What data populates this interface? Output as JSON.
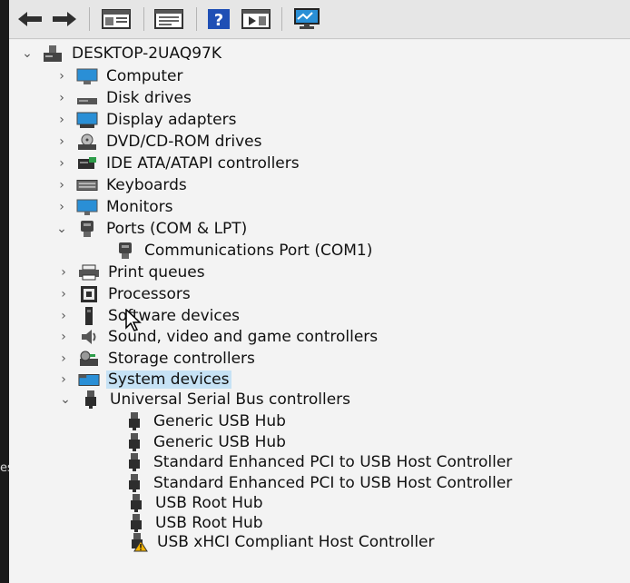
{
  "left_edge_text": "es",
  "toolbar": {
    "buttons": [
      {
        "icon": "back-arrow-icon"
      },
      {
        "icon": "forward-arrow-icon"
      },
      {
        "icon": "show-hide-console-tree-icon"
      },
      {
        "icon": "properties-icon"
      },
      {
        "icon": "help-icon"
      },
      {
        "icon": "action-pane-icon"
      },
      {
        "icon": "scan-hardware-icon"
      }
    ]
  },
  "tree": {
    "root": {
      "label": "DESKTOP-2UAQ97K",
      "icon": "computer-tower-icon",
      "expanded": true
    },
    "categories": [
      {
        "label": "Computer",
        "icon": "computer-icon",
        "expanded": false
      },
      {
        "label": "Disk drives",
        "icon": "disk-drive-icon",
        "expanded": false
      },
      {
        "label": "Display adapters",
        "icon": "display-adapter-icon",
        "expanded": false
      },
      {
        "label": "DVD/CD-ROM drives",
        "icon": "dvd-drive-icon",
        "expanded": false
      },
      {
        "label": "IDE ATA/ATAPI controllers",
        "icon": "ide-controller-icon",
        "expanded": false
      },
      {
        "label": "Keyboards",
        "icon": "keyboard-icon",
        "expanded": false
      },
      {
        "label": "Monitors",
        "icon": "monitor-icon",
        "expanded": false
      },
      {
        "label": "Ports (COM & LPT)",
        "icon": "port-icon",
        "expanded": true,
        "children": [
          {
            "label": "Communications Port (COM1)",
            "icon": "port-icon"
          }
        ]
      },
      {
        "label": "Print queues",
        "icon": "printer-icon",
        "expanded": false
      },
      {
        "label": "Processors",
        "icon": "processor-icon",
        "expanded": false
      },
      {
        "label": "Software devices",
        "icon": "software-device-icon",
        "expanded": false
      },
      {
        "label": "Sound, video and game controllers",
        "icon": "speaker-icon",
        "expanded": false
      },
      {
        "label": "Storage controllers",
        "icon": "storage-controller-icon",
        "expanded": false
      },
      {
        "label": "System devices",
        "icon": "system-devices-icon",
        "expanded": false,
        "selected": true
      },
      {
        "label": "Universal Serial Bus controllers",
        "icon": "usb-icon",
        "expanded": true,
        "children": [
          {
            "label": "Generic USB Hub",
            "icon": "usb-icon"
          },
          {
            "label": "Generic USB Hub",
            "icon": "usb-icon"
          },
          {
            "label": "Standard Enhanced PCI to USB Host Controller",
            "icon": "usb-icon"
          },
          {
            "label": "Standard Enhanced PCI to USB Host Controller",
            "icon": "usb-icon"
          },
          {
            "label": "USB Root Hub",
            "icon": "usb-icon"
          },
          {
            "label": "USB Root Hub",
            "icon": "usb-icon"
          },
          {
            "label": "USB xHCI Compliant Host Controller",
            "icon": "usb-warning-icon",
            "warning": true
          }
        ]
      }
    ]
  },
  "colors": {
    "selection": "#c6e2f5",
    "warning": "#f2b100",
    "icon_blue": "#2a8fd6"
  }
}
